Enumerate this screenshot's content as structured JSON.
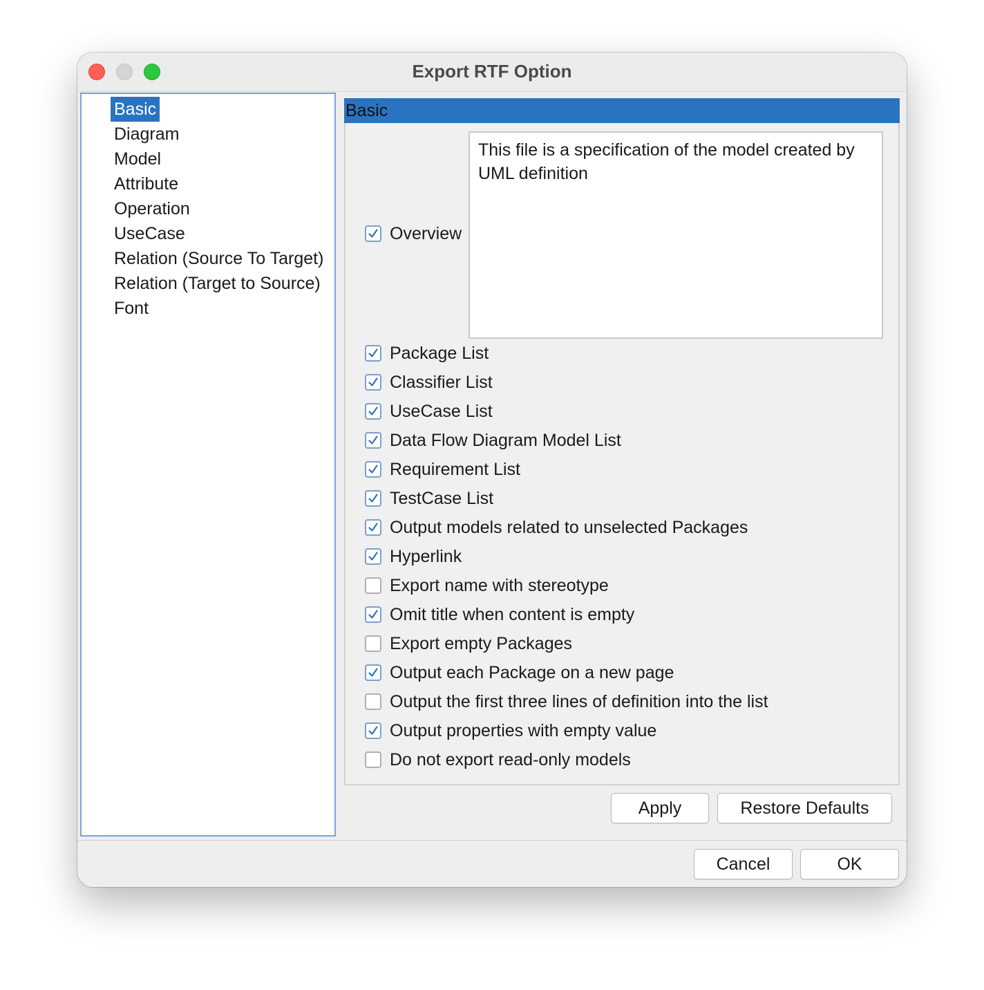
{
  "window": {
    "title": "Export RTF Option"
  },
  "tree": {
    "items": [
      {
        "label": "Basic",
        "selected": true
      },
      {
        "label": "Diagram",
        "selected": false
      },
      {
        "label": "Model",
        "selected": false
      },
      {
        "label": "Attribute",
        "selected": false
      },
      {
        "label": "Operation",
        "selected": false
      },
      {
        "label": "UseCase",
        "selected": false
      },
      {
        "label": "Relation (Source To Target)",
        "selected": false
      },
      {
        "label": "Relation (Target to Source)",
        "selected": false
      },
      {
        "label": "Font",
        "selected": false
      }
    ]
  },
  "panel": {
    "header": "Basic",
    "overview": {
      "label": "Overview",
      "checked": true,
      "text": "This file is a specification of the model created by UML definition"
    },
    "options": [
      {
        "label": "Package List",
        "checked": true
      },
      {
        "label": "Classifier List",
        "checked": true
      },
      {
        "label": "UseCase List",
        "checked": true
      },
      {
        "label": "Data Flow Diagram Model List",
        "checked": true
      },
      {
        "label": "Requirement List",
        "checked": true
      },
      {
        "label": "TestCase List",
        "checked": true
      },
      {
        "label": "Output models related to unselected Packages",
        "checked": true
      },
      {
        "label": "Hyperlink",
        "checked": true
      },
      {
        "label": "Export name with stereotype",
        "checked": false
      },
      {
        "label": "Omit title when content is empty",
        "checked": true
      },
      {
        "label": "Export empty Packages",
        "checked": false
      },
      {
        "label": "Output each Package on a new page",
        "checked": true
      },
      {
        "label": "Output the first three lines of definition into the list",
        "checked": false
      },
      {
        "label": "Output properties with empty value",
        "checked": true
      },
      {
        "label": "Do not export read-only models",
        "checked": false
      }
    ],
    "apply_label": "Apply",
    "restore_label": "Restore Defaults"
  },
  "footer": {
    "cancel_label": "Cancel",
    "ok_label": "OK"
  },
  "colors": {
    "selection": "#2a73c0",
    "checkmark": "#2a73c0",
    "close": "#fe5f57",
    "minimize": "#d4d4d4",
    "maximize": "#2bc840"
  }
}
